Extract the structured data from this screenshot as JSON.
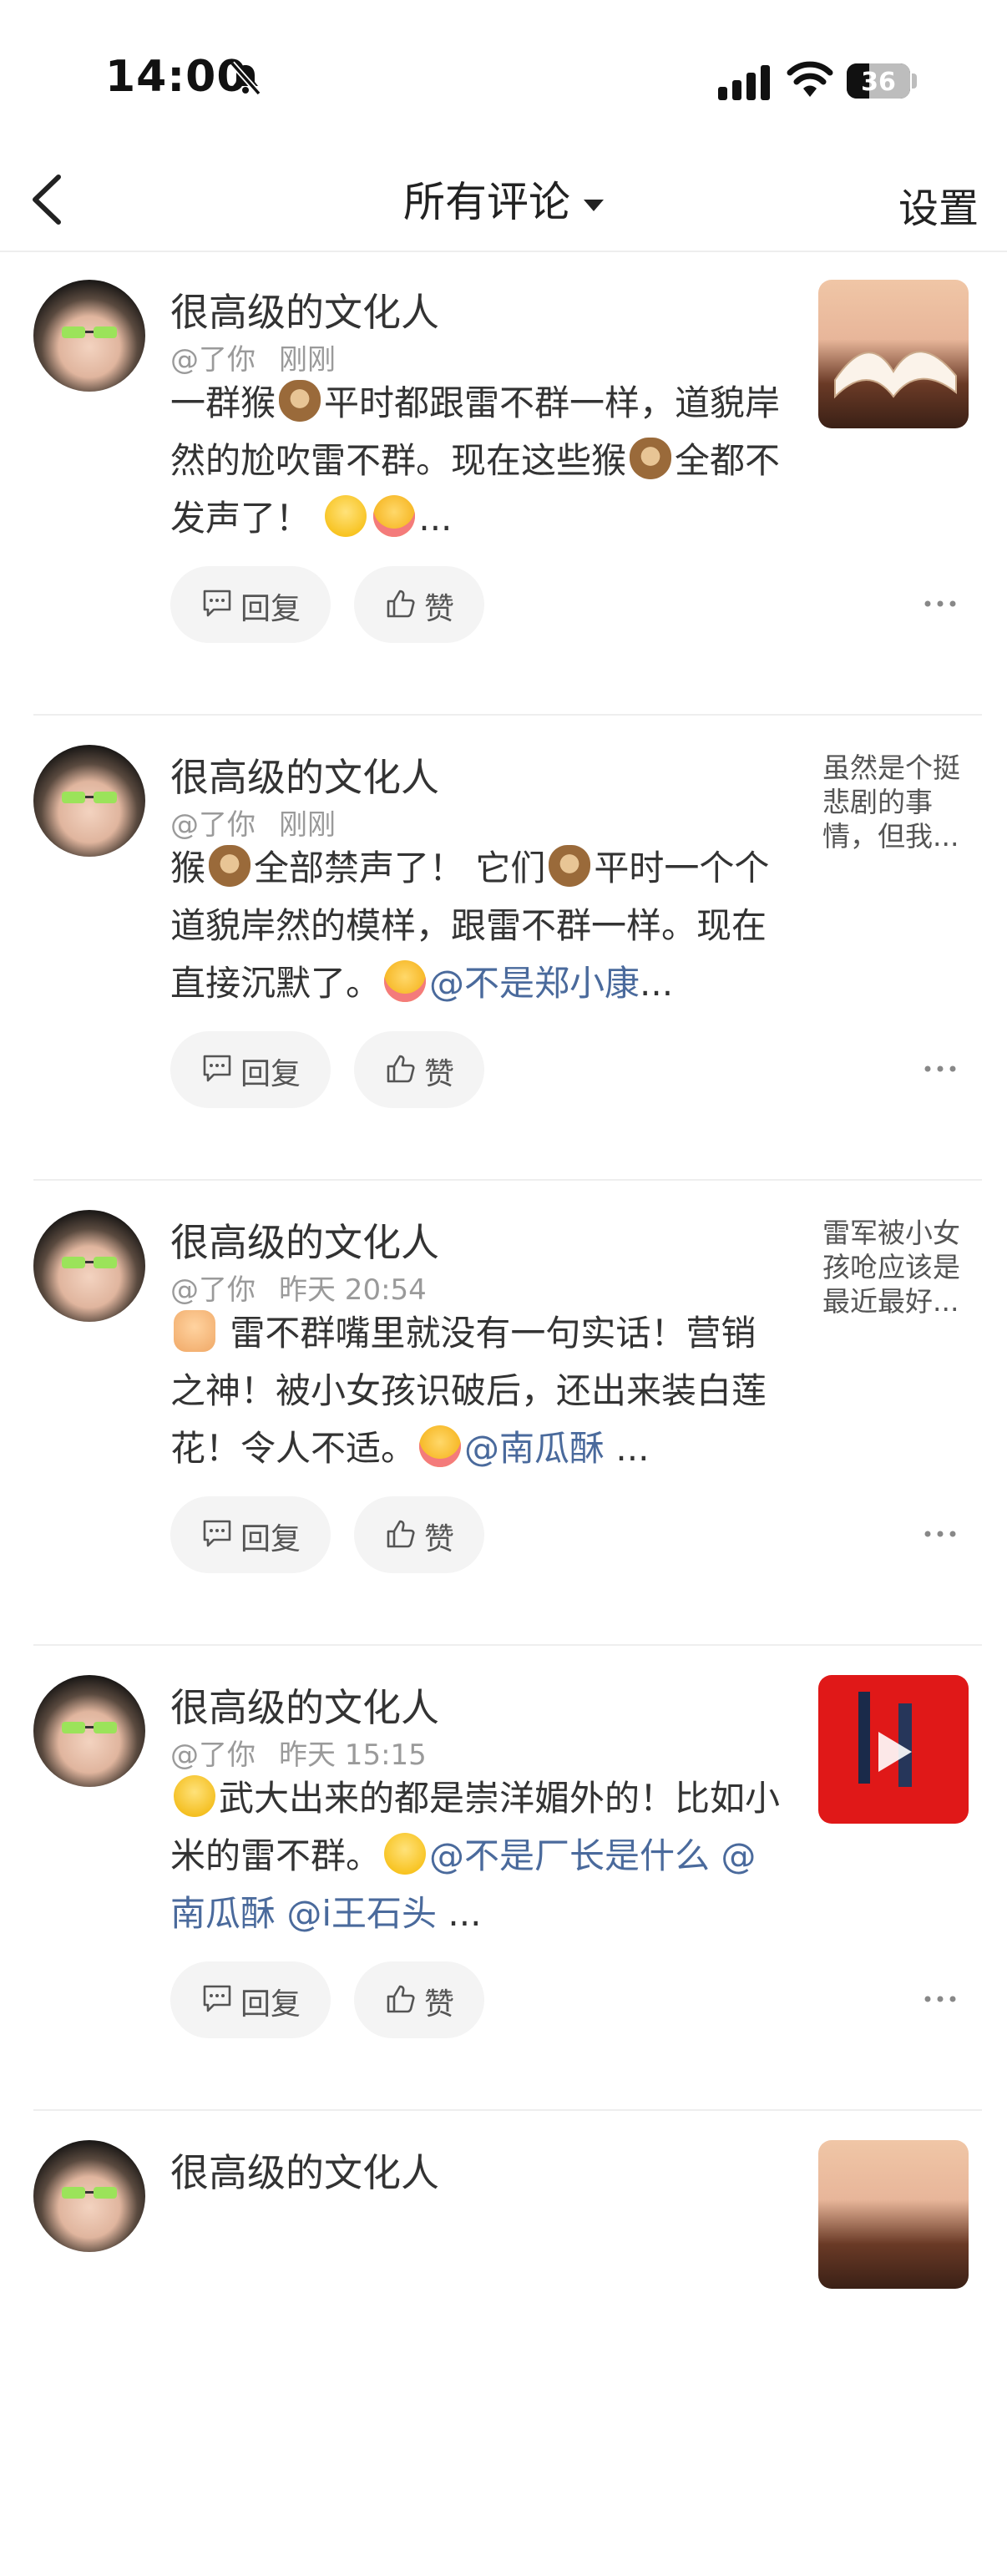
{
  "status_bar": {
    "time": "14:00",
    "battery": "36",
    "battery_level": 0.36
  },
  "nav": {
    "title": "所有评论",
    "settings": "设置"
  },
  "comments": [
    {
      "user": "很高级的文化人",
      "target": "@了你",
      "time": "刚刚",
      "segments": [
        {
          "t": "text",
          "v": "一群猴"
        },
        {
          "t": "emoji",
          "v": "monkey"
        },
        {
          "t": "text",
          "v": "平时都跟雷不群一样，道貌岸然的尬吹雷不群。现在这些猴"
        },
        {
          "t": "emoji",
          "v": "monkey"
        },
        {
          "t": "text",
          "v": "全都不发声了！ "
        },
        {
          "t": "emoji",
          "v": "grin"
        },
        {
          "t": "emoji",
          "v": "blush"
        },
        {
          "t": "text",
          "v": "..."
        }
      ],
      "reply": "回复",
      "like": "赞",
      "thumb": "book-image"
    },
    {
      "user": "很高级的文化人",
      "target": "@了你",
      "time": "刚刚",
      "segments": [
        {
          "t": "text",
          "v": "猴"
        },
        {
          "t": "emoji",
          "v": "monkey"
        },
        {
          "t": "text",
          "v": "全部禁声了！ 它们"
        },
        {
          "t": "emoji",
          "v": "monkey"
        },
        {
          "t": "text",
          "v": "平时一个个道貌岸然的模样，跟雷不群一样。现在直接沉默了。"
        },
        {
          "t": "emoji",
          "v": "blush"
        },
        {
          "t": "mention",
          "v": "@不是郑小康"
        },
        {
          "t": "text",
          "v": "..."
        }
      ],
      "reply": "回复",
      "like": "赞",
      "quote": "虽然是个挺悲剧的事情，但我..."
    },
    {
      "user": "很高级的文化人",
      "target": "@了你",
      "time": "昨天 20:54",
      "segments": [
        {
          "t": "emoji",
          "v": "thumb"
        },
        {
          "t": "text",
          "v": " 雷不群嘴里就没有一句实话！营销之神！被小女孩识破后，还出来装白莲花！令人不适。"
        },
        {
          "t": "emoji",
          "v": "blush"
        },
        {
          "t": "mention",
          "v": "@南瓜酥"
        },
        {
          "t": "text",
          "v": " ..."
        }
      ],
      "reply": "回复",
      "like": "赞",
      "quote": "雷军被小女孩呛应该是最近最好..."
    },
    {
      "user": "很高级的文化人",
      "target": "@了你",
      "time": "昨天 15:15",
      "segments": [
        {
          "t": "emoji",
          "v": "sweat"
        },
        {
          "t": "text",
          "v": "武大出来的都是崇洋媚外的！比如小米的雷不群。"
        },
        {
          "t": "emoji",
          "v": "grin"
        },
        {
          "t": "mention",
          "v": "@不是厂长是什么"
        },
        {
          "t": "text",
          "v": " "
        },
        {
          "t": "mention",
          "v": "@南瓜酥"
        },
        {
          "t": "text",
          "v": " "
        },
        {
          "t": "mention",
          "v": "@i王石头"
        },
        {
          "t": "text",
          "v": " ..."
        }
      ],
      "reply": "回复",
      "like": "赞",
      "thumb": "video-image"
    },
    {
      "user": "很高级的文化人",
      "partial": true,
      "thumb": "crowd-image"
    }
  ],
  "colors": {
    "mention": "#4a6a9c",
    "meta": "#9a9a9a",
    "divider": "#eeeeee",
    "button_bg": "#f4f4f4"
  }
}
